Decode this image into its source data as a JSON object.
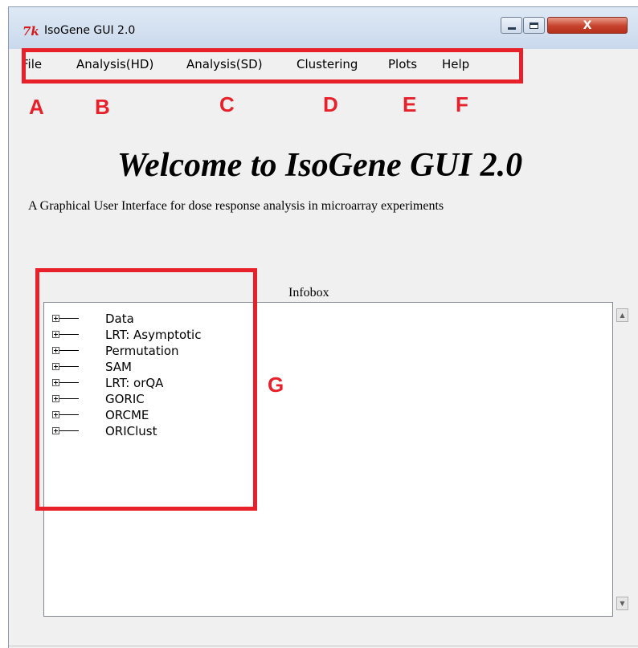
{
  "window": {
    "title": "IsoGene GUI 2.0",
    "icon_text": "7k",
    "close_label": "X"
  },
  "menu": {
    "items": [
      {
        "label": "File",
        "marker": "A"
      },
      {
        "label": "Analysis(HD)",
        "marker": "B"
      },
      {
        "label": "Analysis(SD)",
        "marker": "C"
      },
      {
        "label": "Clustering",
        "marker": "D"
      },
      {
        "label": "Plots",
        "marker": "E"
      },
      {
        "label": "Help",
        "marker": "F"
      }
    ]
  },
  "main": {
    "welcome": "Welcome to IsoGene GUI 2.0",
    "subtitle": "A Graphical User Interface for dose response analysis in microarray experiments"
  },
  "infobox": {
    "label": "Infobox",
    "marker": "G",
    "items": [
      "Data",
      "LRT: Asymptotic",
      "Permutation",
      "SAM",
      "LRT: orQA",
      "GORIC",
      "ORCME",
      "ORIClust"
    ]
  },
  "annotation_color": "#e8202a"
}
